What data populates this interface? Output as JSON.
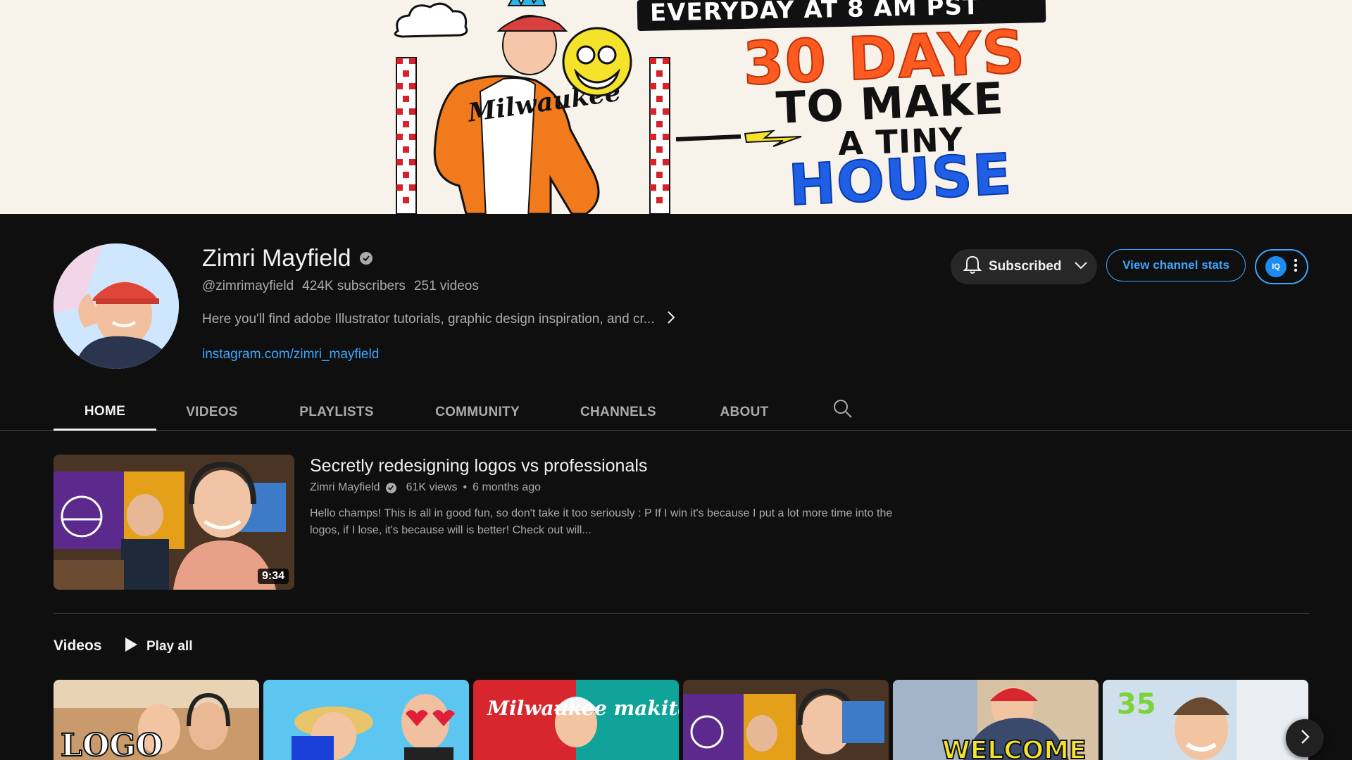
{
  "banner": {
    "line1_a": "EVERYDAY",
    "line1_b": "AT 8 AM",
    "line1_c": "PST",
    "line2": "30 DAYS",
    "line3": "TO MAKE",
    "line4": "A TINY",
    "line5": "HOUSE",
    "jacket_text": "Milwaukee"
  },
  "channel": {
    "name": "Zimri Mayfield",
    "handle": "@zimrimayfield",
    "subscribers": "424K subscribers",
    "videos": "251 videos",
    "description": "Here you'll find adobe Illustrator tutorials, graphic design inspiration, and cr...",
    "link": "instagram.com/zimri_mayfield"
  },
  "actions": {
    "subscribed_label": "Subscribed",
    "stats_label": "View channel stats",
    "ext_label": "IQ"
  },
  "tabs": [
    {
      "label": "HOME"
    },
    {
      "label": "VIDEOS"
    },
    {
      "label": "PLAYLISTS"
    },
    {
      "label": "COMMUNITY"
    },
    {
      "label": "CHANNELS"
    },
    {
      "label": "ABOUT"
    }
  ],
  "featured": {
    "title": "Secretly redesigning logos vs professionals",
    "channel": "Zimri Mayfield",
    "views": "61K views",
    "age": "6 months ago",
    "separator": "•",
    "description": "Hello champs! This is all in good fun, so don't take it too seriously : P If I win it's because I put a lot more time into the logos, if I lose, it's because will is better! Check out will...",
    "duration": "9:34"
  },
  "shelf": {
    "title": "Videos",
    "play_all": "Play all",
    "thumbs": [
      {
        "text": "LOGO"
      },
      {
        "text": ""
      },
      {
        "text": "Milwaukee  makita"
      },
      {
        "text": ""
      },
      {
        "text": "WELCOME"
      },
      {
        "text": "35"
      }
    ]
  },
  "colors": {
    "background": "#0f0f0f",
    "link": "#3ea6ff",
    "accent_orange": "#ff5a1f",
    "accent_blue": "#1e5fe6"
  },
  "icons": [
    "verified-icon",
    "bell-icon",
    "chevron-down-icon",
    "chevron-right-icon",
    "search-icon",
    "play-icon",
    "more-vert-icon",
    "next-arrow-icon"
  ]
}
